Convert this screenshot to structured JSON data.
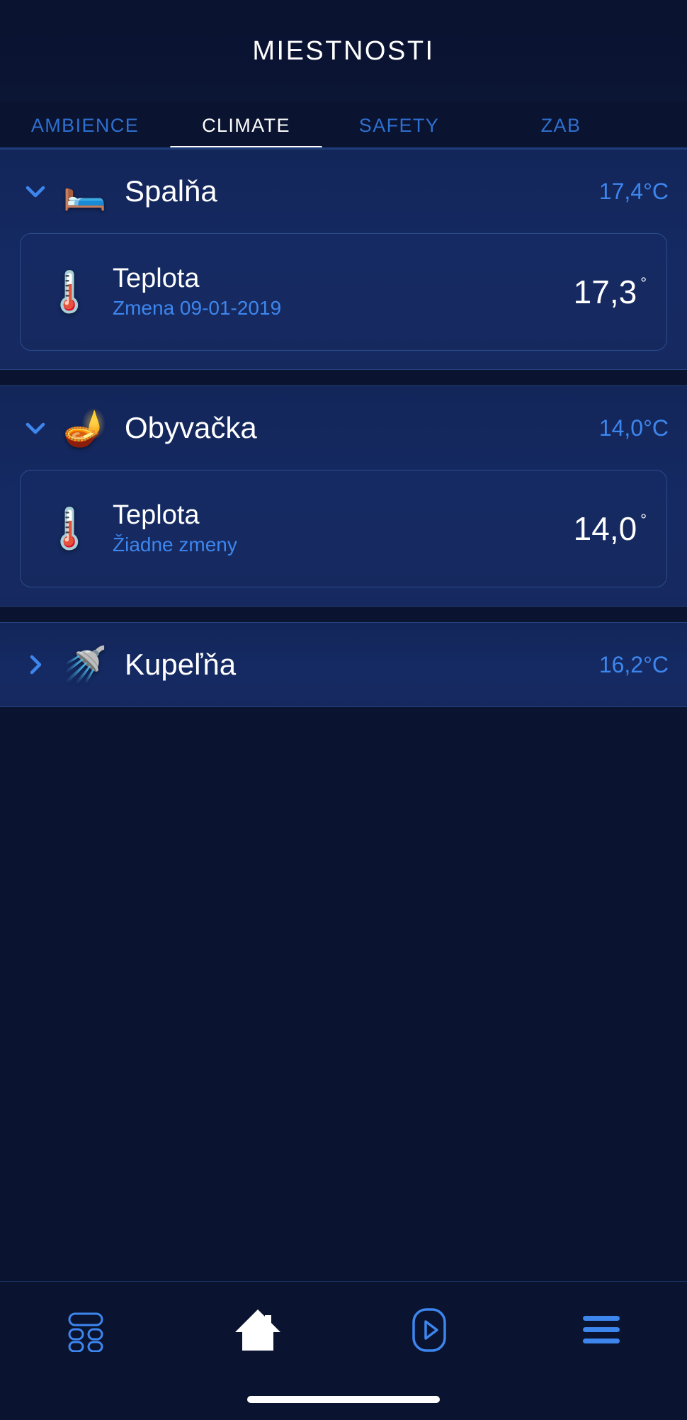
{
  "header": {
    "title": "MIESTNOSTI"
  },
  "tabs": [
    {
      "label": "AMBIENCE",
      "active": false
    },
    {
      "label": "CLIMATE",
      "active": true
    },
    {
      "label": "SAFETY",
      "active": false
    },
    {
      "label": "ZAB",
      "active": false
    }
  ],
  "rooms": [
    {
      "name": "Spalňa",
      "emoji": "🛏️",
      "emoji_name": "bed-icon",
      "temperature": "17,4°C",
      "expanded": true,
      "chevron": "chevron-down-icon",
      "devices": [
        {
          "emoji": "🌡️",
          "emoji_name": "thermometer-icon",
          "title": "Teplota",
          "subtitle": "Zmena 09-01-2019",
          "value": "17,3",
          "unit": "°"
        }
      ]
    },
    {
      "name": "Obyvačka",
      "emoji": "🪔",
      "emoji_name": "fireplace-icon",
      "temperature": "14,0°C",
      "expanded": true,
      "chevron": "chevron-down-icon",
      "devices": [
        {
          "emoji": "🌡️",
          "emoji_name": "thermometer-icon",
          "title": "Teplota",
          "subtitle": "Žiadne zmeny",
          "value": "14,0",
          "unit": "°"
        }
      ]
    },
    {
      "name": "Kupeľňa",
      "emoji": "🚿",
      "emoji_name": "shower-icon",
      "temperature": "16,2°C",
      "expanded": false,
      "chevron": "chevron-right-icon",
      "devices": []
    }
  ],
  "bottom_nav": [
    {
      "name": "dashboard-icon",
      "active": false
    },
    {
      "name": "home-icon",
      "active": true
    },
    {
      "name": "media-play-icon",
      "active": false
    },
    {
      "name": "menu-icon",
      "active": false
    }
  ],
  "colors": {
    "background": "#0a1330",
    "card": "#16295f",
    "accent": "#3d86ee",
    "accent_dim": "#2f6fd0",
    "text": "#ffffff",
    "border": "#2b4d8c"
  }
}
